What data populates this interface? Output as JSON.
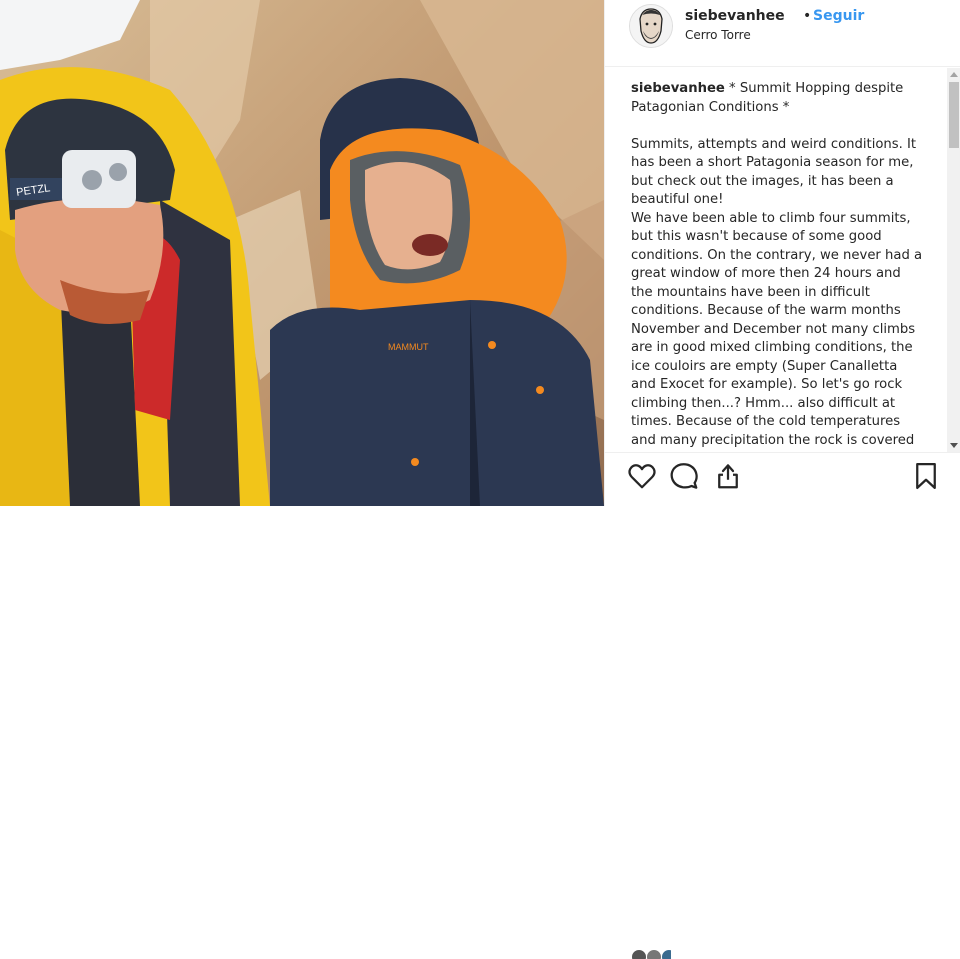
{
  "post": {
    "username": "siebevanhee",
    "dot": "•",
    "follow_label": "Seguir",
    "location": "Cerro Torre",
    "caption_username": "siebevanhee",
    "caption_text": " * Summit Hopping despite Patagonian Conditions *\n\nSummits, attempts and weird conditions. It has been a short Patagonia season for me, but check out the images, it has been a beautiful one!\nWe have been able to climb four summits, but this wasn't because of some good conditions. On the contrary, we never had a great window of more then 24 hours and the mountains have been in difficult conditions. Because of the warm months November and December not many climbs are in good mixed climbing conditions, the ice couloirs are empty (Super Canalletta and Exocet for example). So let's go rock climbing then...? Hmm... also difficult at times. Because of the cold temperatures and many precipitation the rock is covered",
    "photo_brands": {
      "headlamp": "PETZL",
      "jacket": "MAMMUT"
    }
  },
  "icons": {
    "like": "heart-icon",
    "comment": "comment-icon",
    "share": "share-icon",
    "save": "bookmark-icon"
  }
}
